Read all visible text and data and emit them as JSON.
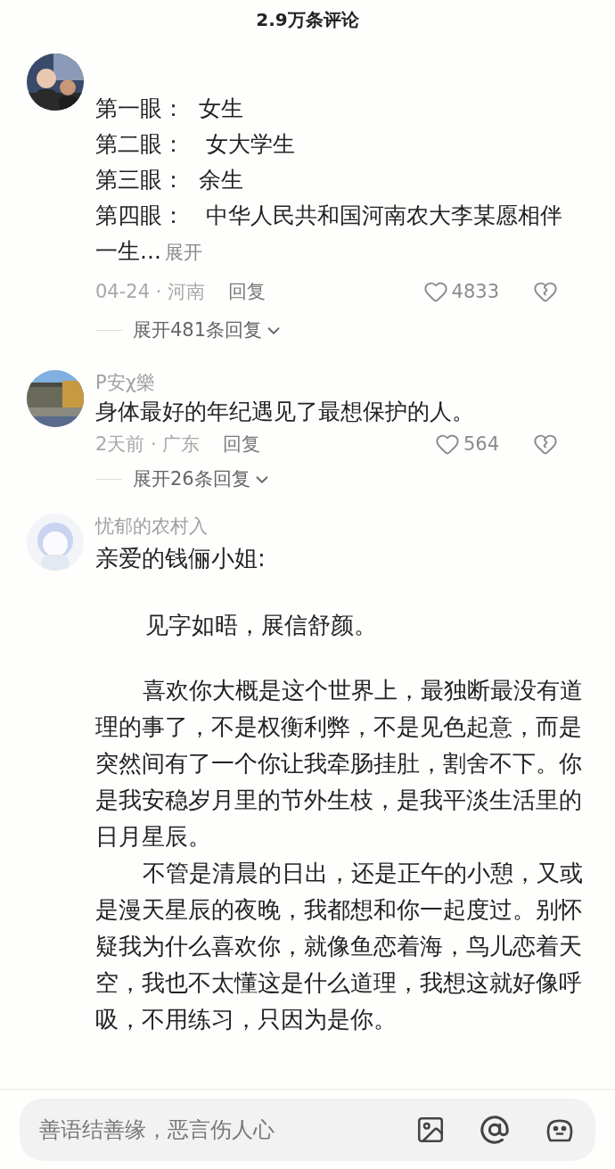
{
  "header": {
    "title": "2.9万条评论"
  },
  "comments": [
    {
      "kind": "lines",
      "lines": [
        "第一眼：  女生",
        "第二眼：   女大学生",
        "第三眼：  余生",
        "第四眼：   中华人民共和国河南农大李某愿相伴",
        "一生..."
      ],
      "expand": "展开",
      "date": "04-24 · 河南",
      "reply": "回复",
      "likes": "4833",
      "thread": "展开481条回复"
    },
    {
      "kind": "short",
      "user": "P安χ樂",
      "text": "身体最好的年纪遇见了最想保护的人。",
      "date": "2天前 · 广东",
      "reply": "回复",
      "likes": "564",
      "thread": "展开26条回复"
    },
    {
      "kind": "letter",
      "user": "忧郁的农村入",
      "paragraphs": [
        {
          "kind": "salutation",
          "text": "亲爱的钱俪小姐:"
        },
        {
          "kind": "greeting",
          "text": "见字如晤，展信舒颜。"
        },
        {
          "kind": "body",
          "text": "喜欢你大概是这个世界上，最独断最没有道理的事了，不是权衡利弊，不是见色起意，而是突然间有了一个你让我牵肠挂肚，割舍不下。你是我安稳岁月里的节外生枝，是我平淡生活里的日月星辰。"
        },
        {
          "kind": "body",
          "text": "不管是清晨的日出，还是正午的小憩，又或是漫天星辰的夜晚，我都想和你一起度过。别怀疑我为什么喜欢你，就像鱼恋着海，鸟儿恋着天空，我也不太懂这是什么道理，我想这就好像呼吸，不用练习，只因为是你。"
        }
      ]
    }
  ],
  "composer": {
    "placeholder": "善语结善缘，恶言伤人心"
  }
}
